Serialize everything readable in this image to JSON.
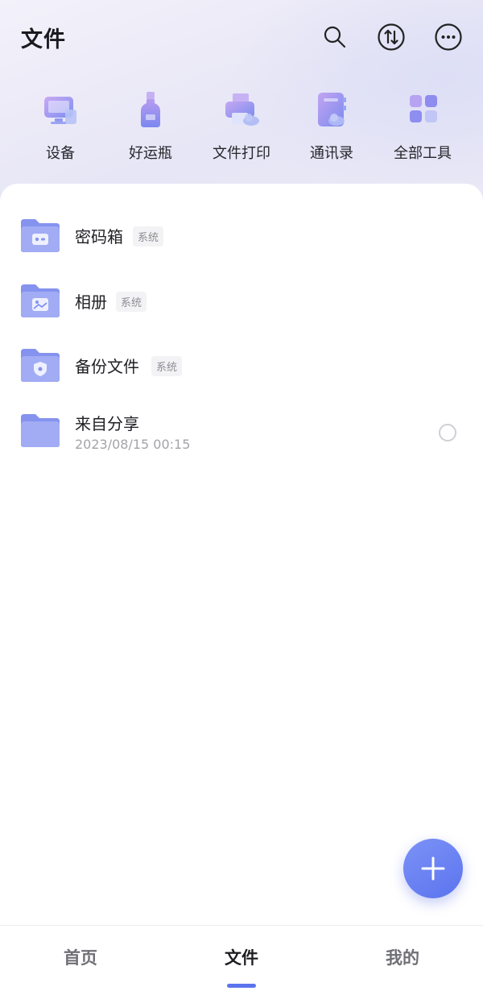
{
  "header": {
    "title": "文件",
    "actions": [
      {
        "icon": "search-icon"
      },
      {
        "icon": "transfer-icon"
      },
      {
        "icon": "more-icon"
      }
    ]
  },
  "tools": [
    {
      "label": "设备",
      "icon": "device-icon"
    },
    {
      "label": "好运瓶",
      "icon": "bottle-icon"
    },
    {
      "label": "文件打印",
      "icon": "printer-icon"
    },
    {
      "label": "通讯录",
      "icon": "contacts-icon"
    },
    {
      "label": "全部工具",
      "icon": "all-tools-icon"
    }
  ],
  "folders": [
    {
      "name": "密码箱",
      "tag": "系统",
      "icon": "safe-folder-icon"
    },
    {
      "name": "相册",
      "tag": "系统",
      "icon": "album-folder-icon"
    },
    {
      "name": "备份文件",
      "tag": "系统",
      "icon": "backup-folder-icon"
    },
    {
      "name": "来自分享",
      "date": "2023/08/15 00:15",
      "icon": "shared-folder-icon",
      "selected": false
    }
  ],
  "fab": {
    "icon": "plus-icon"
  },
  "bottom_nav": {
    "items": [
      {
        "label": "首页",
        "active": false
      },
      {
        "label": "文件",
        "active": true
      },
      {
        "label": "我的",
        "active": false
      }
    ]
  },
  "colors": {
    "accent": "#5b74ee",
    "folder": "#8593ef",
    "folder_light": "#b9c1f7",
    "header_bg": "#eceaf7"
  }
}
